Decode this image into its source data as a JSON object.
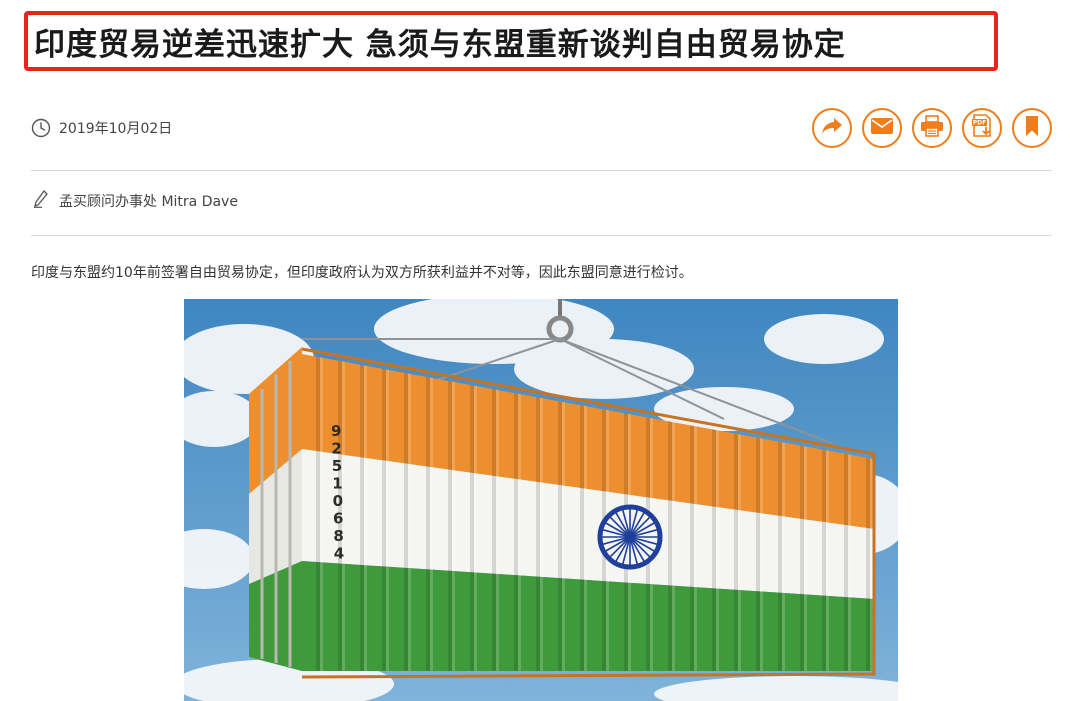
{
  "article": {
    "title": "印度贸易逆差迅速扩大 急须与东盟重新谈判自由贸易协定",
    "date": "2019年10月02日",
    "author": "孟买顾问办事处 Mitra Dave",
    "summary": "印度与东盟约10年前签署自由贸易协定，但印度政府认为双方所获利益并不对等，因此东盟同意进行检讨。"
  },
  "actions": {
    "share_icon": "share-arrow-icon",
    "email_icon": "envelope-icon",
    "print_icon": "printer-icon",
    "pdf_icon": "pdf-download-icon",
    "pdf_label": "PDF",
    "bookmark_icon": "bookmark-icon"
  },
  "photo": {
    "container_number": "92510684",
    "colors": {
      "saffron": "#ee8f2f",
      "white": "#f5f5f2",
      "green": "#3f9a3c",
      "chakra": "#1f3f9a",
      "sky": "#4b8ec2"
    }
  },
  "colors": {
    "accent": "#ee7d1b",
    "highlight_border": "#e8231d"
  }
}
